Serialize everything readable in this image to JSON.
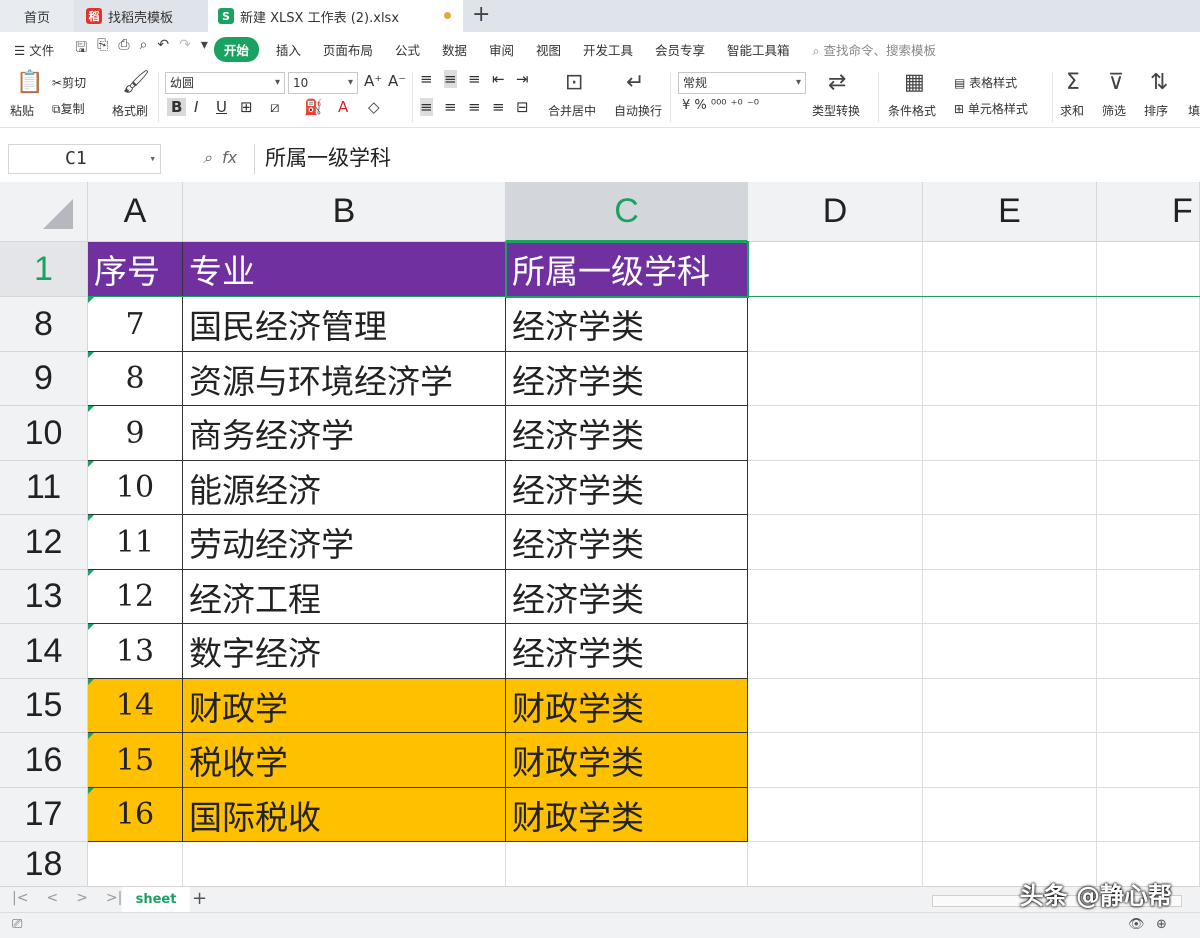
{
  "tabs": {
    "home": "首页",
    "template": "找稻壳模板",
    "file": "新建 XLSX 工作表 (2).xlsx",
    "new_tab": "+"
  },
  "menu": {
    "file": "文件",
    "items": [
      "开始",
      "插入",
      "页面布局",
      "公式",
      "数据",
      "审阅",
      "视图",
      "开发工具",
      "会员专享",
      "智能工具箱"
    ],
    "active": "开始",
    "search": "查找命令、搜索模板"
  },
  "ribbon": {
    "paste": "粘贴",
    "cut": "剪切",
    "copy": "复制",
    "format_painter": "格式刷",
    "font": "幼圆",
    "font_size": "10",
    "merge": "合并居中",
    "wrap": "自动换行",
    "number_format": "常规",
    "convert": "类型转换",
    "cond_format": "条件格式",
    "table_style": "表格样式",
    "cell_style": "单元格样式",
    "sum": "求和",
    "filter": "筛选",
    "sort": "排序",
    "fill": "填"
  },
  "formula_bar": {
    "cell_ref": "C1",
    "fx": "fx",
    "content": "所属一级学科"
  },
  "columns": [
    "A",
    "B",
    "C",
    "D",
    "E",
    "F"
  ],
  "selected_column": "C",
  "header_row": {
    "row_label": "1",
    "cells": [
      "序号",
      "专业",
      "所属一级学科"
    ]
  },
  "rows": [
    {
      "row_label": "8",
      "num": "7",
      "major": "国民经济管理",
      "category": "经济学类",
      "highlight": false
    },
    {
      "row_label": "9",
      "num": "8",
      "major": "资源与环境经济学",
      "category": "经济学类",
      "highlight": false
    },
    {
      "row_label": "10",
      "num": "9",
      "major": "商务经济学",
      "category": "经济学类",
      "highlight": false
    },
    {
      "row_label": "11",
      "num": "10",
      "major": "能源经济",
      "category": "经济学类",
      "highlight": false
    },
    {
      "row_label": "12",
      "num": "11",
      "major": "劳动经济学",
      "category": "经济学类",
      "highlight": false
    },
    {
      "row_label": "13",
      "num": "12",
      "major": "经济工程",
      "category": "经济学类",
      "highlight": false
    },
    {
      "row_label": "14",
      "num": "13",
      "major": "数字经济",
      "category": "经济学类",
      "highlight": false
    },
    {
      "row_label": "15",
      "num": "14",
      "major": "财政学",
      "category": "财政学类",
      "highlight": true
    },
    {
      "row_label": "16",
      "num": "15",
      "major": "税收学",
      "category": "财政学类",
      "highlight": true
    },
    {
      "row_label": "17",
      "num": "16",
      "major": "国际税收",
      "category": "财政学类",
      "highlight": true
    },
    {
      "row_label": "18",
      "num": "",
      "major": "",
      "category": "",
      "highlight": false
    }
  ],
  "colors": {
    "header_fill": "#7030a0",
    "highlight_fill": "#ffc000",
    "accent": "#1aa260"
  },
  "sheet": {
    "name": "sheet",
    "add": "+"
  },
  "watermark": "头条 @静心帮"
}
